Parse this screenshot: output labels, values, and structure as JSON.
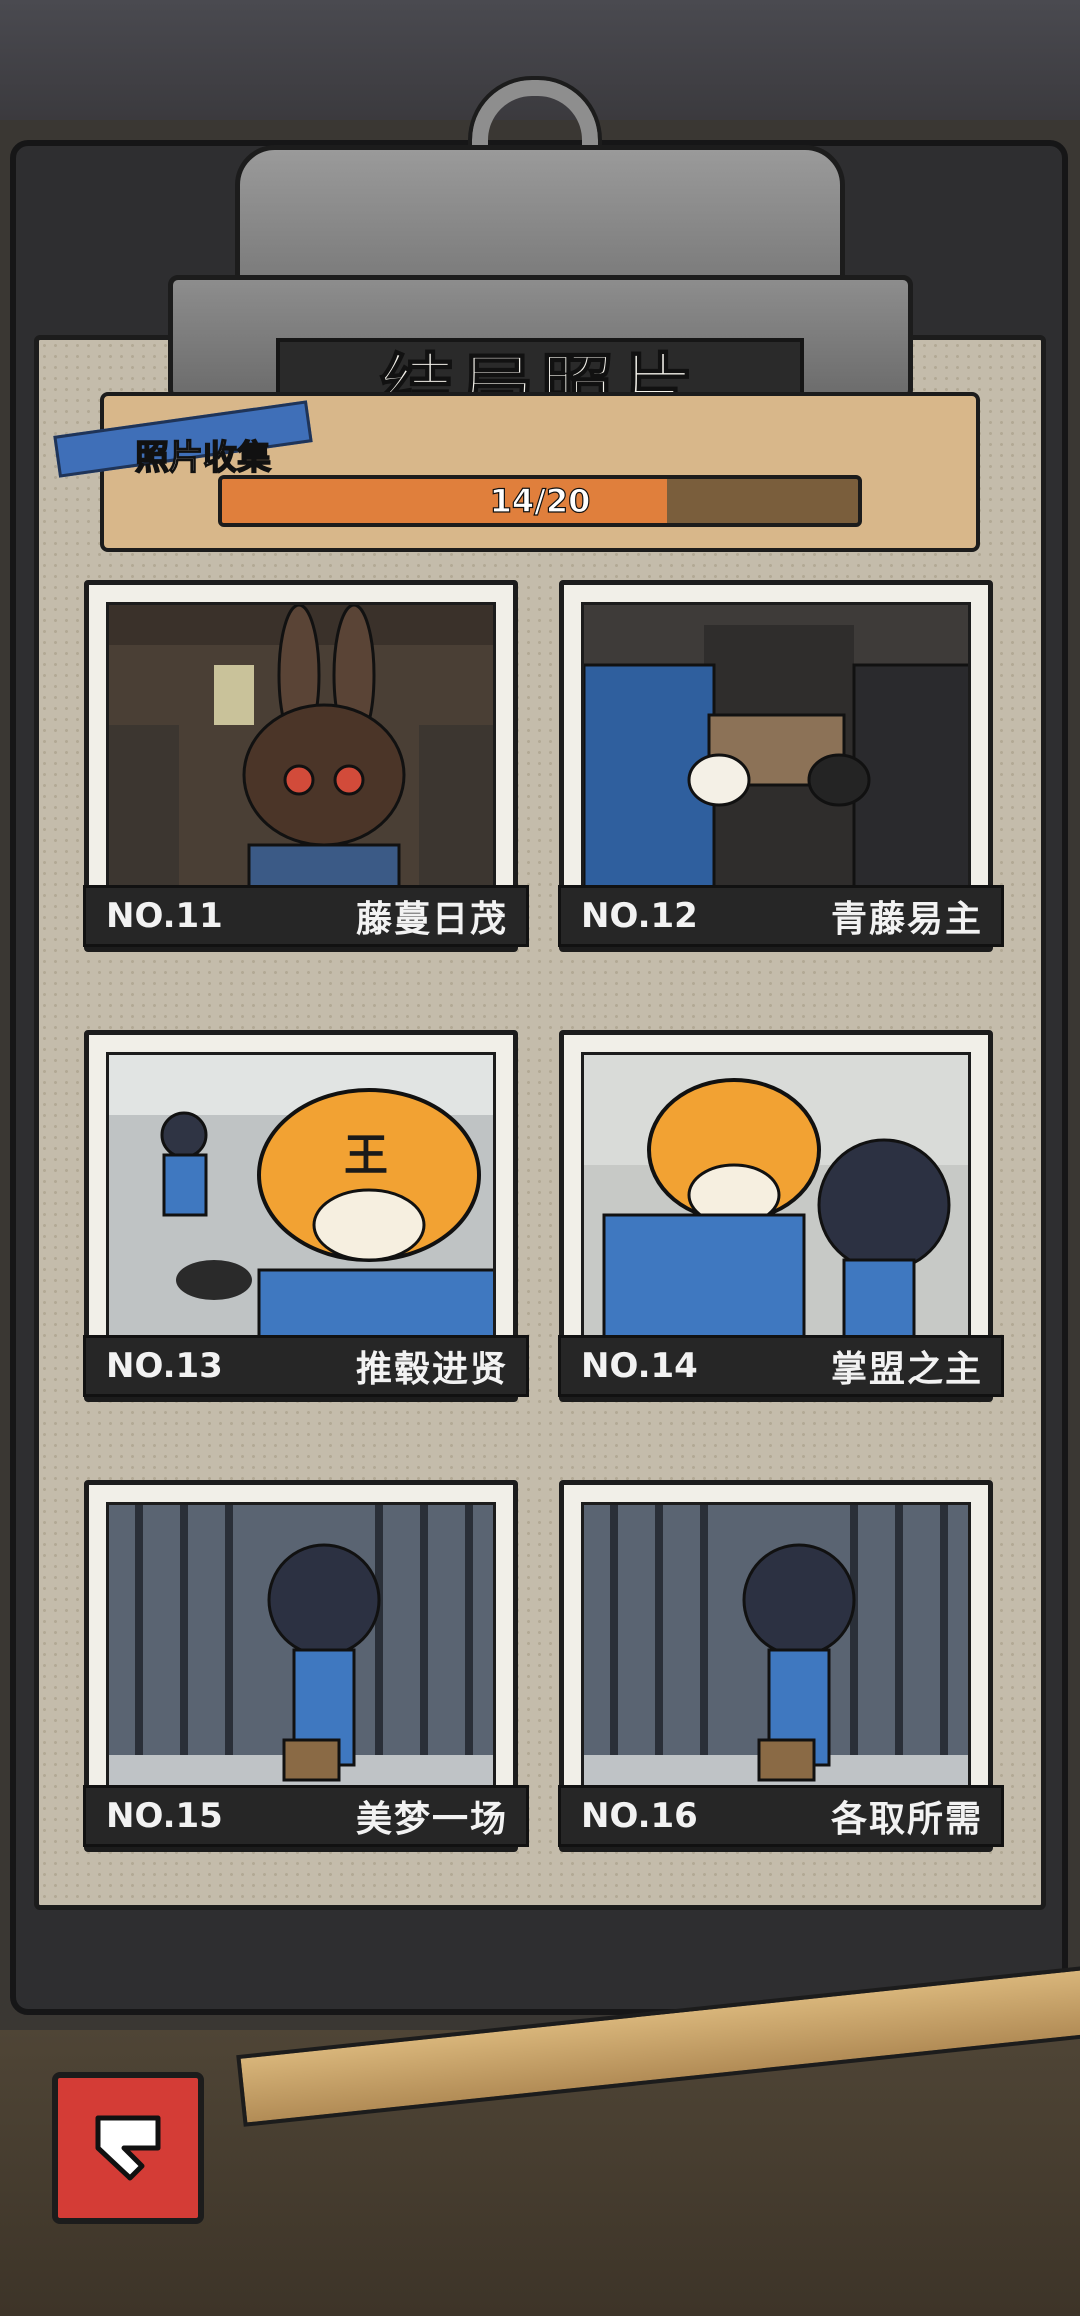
{
  "header": {
    "title": "结局照片"
  },
  "progress": {
    "label": "照片收集",
    "value_text": "14/20",
    "collected": 14,
    "total": 20,
    "fraction": 0.7
  },
  "cards": [
    {
      "no": "NO.11",
      "name": "藤蔓日茂",
      "scene": "rabbit-mask-prisoner-in-cell"
    },
    {
      "no": "NO.12",
      "name": "青藤易主",
      "scene": "box-handover"
    },
    {
      "no": "NO.13",
      "name": "推毂进贤",
      "scene": "tiger-mask-inmate"
    },
    {
      "no": "NO.14",
      "name": "掌盟之主",
      "scene": "tiger-mask-with-boy"
    },
    {
      "no": "NO.15",
      "name": "美梦一场",
      "scene": "boy-leaving-prison"
    },
    {
      "no": "NO.16",
      "name": "各取所需",
      "scene": "boy-leaving-prison"
    }
  ],
  "colors": {
    "paper": "#c4bcab",
    "progress_fill": "#e07f3c",
    "back_button": "#d43c36",
    "label_bar": "#262626"
  },
  "icons": {
    "back": "back-arrow-icon"
  }
}
